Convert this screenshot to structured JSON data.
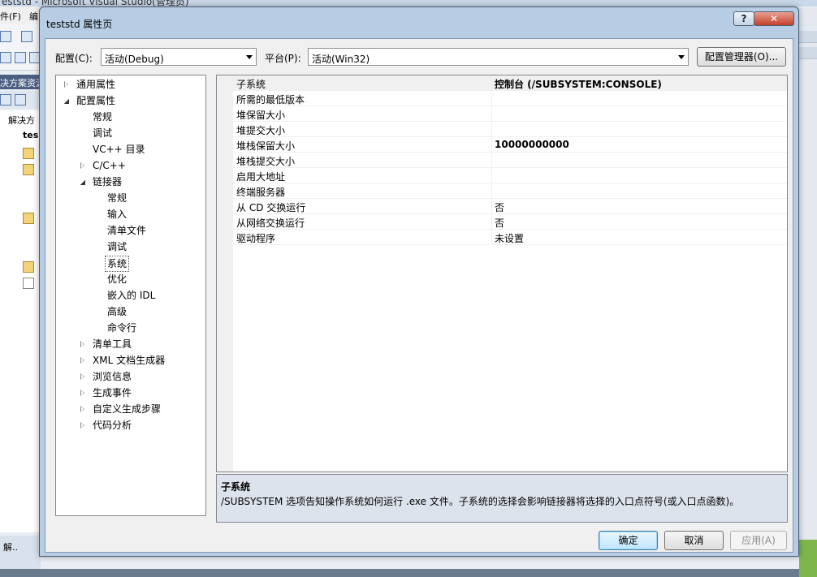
{
  "background": {
    "title_fragment": "eststd - Microsoft Visual Studio(管理员)",
    "menu": [
      "件(F)",
      "编"
    ],
    "solution_explorer_title": "决方案资源",
    "tree_items": [
      "解决方",
      "tes"
    ],
    "bottom_tab": "解.."
  },
  "dialog": {
    "title": "teststd 属性页",
    "help_label": "?",
    "close_label": "✕"
  },
  "config": {
    "label": "配置(C):",
    "value": "活动(Debug)"
  },
  "platform": {
    "label": "平台(P):",
    "value": "活动(Win32)"
  },
  "config_manager_label": "配置管理器(O)...",
  "tree": [
    {
      "label": "通用属性",
      "level": 0,
      "state": "closed"
    },
    {
      "label": "配置属性",
      "level": 0,
      "state": "open"
    },
    {
      "label": "常规",
      "level": 1,
      "state": "leaf"
    },
    {
      "label": "调试",
      "level": 1,
      "state": "leaf"
    },
    {
      "label": "VC++ 目录",
      "level": 1,
      "state": "leaf"
    },
    {
      "label": "C/C++",
      "level": 1,
      "state": "closed"
    },
    {
      "label": "链接器",
      "level": 1,
      "state": "open"
    },
    {
      "label": "常规",
      "level": 2,
      "state": "leaf"
    },
    {
      "label": "输入",
      "level": 2,
      "state": "leaf"
    },
    {
      "label": "清单文件",
      "level": 2,
      "state": "leaf"
    },
    {
      "label": "调试",
      "level": 2,
      "state": "leaf"
    },
    {
      "label": "系统",
      "level": 2,
      "state": "leaf",
      "selected": true
    },
    {
      "label": "优化",
      "level": 2,
      "state": "leaf"
    },
    {
      "label": "嵌入的 IDL",
      "level": 2,
      "state": "leaf"
    },
    {
      "label": "高级",
      "level": 2,
      "state": "leaf"
    },
    {
      "label": "命令行",
      "level": 2,
      "state": "leaf"
    },
    {
      "label": "清单工具",
      "level": 1,
      "state": "closed"
    },
    {
      "label": "XML 文档生成器",
      "level": 1,
      "state": "closed"
    },
    {
      "label": "浏览信息",
      "level": 1,
      "state": "closed"
    },
    {
      "label": "生成事件",
      "level": 1,
      "state": "closed"
    },
    {
      "label": "自定义生成步骤",
      "level": 1,
      "state": "closed"
    },
    {
      "label": "代码分析",
      "level": 1,
      "state": "closed"
    }
  ],
  "properties": [
    {
      "name": "子系统",
      "value": "控制台 (/SUBSYSTEM:CONSOLE)",
      "bold": true,
      "selected": true
    },
    {
      "name": "所需的最低版本",
      "value": ""
    },
    {
      "name": "堆保留大小",
      "value": ""
    },
    {
      "name": "堆提交大小",
      "value": ""
    },
    {
      "name": "堆栈保留大小",
      "value": "10000000000",
      "bold": true
    },
    {
      "name": "堆栈提交大小",
      "value": ""
    },
    {
      "name": "启用大地址",
      "value": ""
    },
    {
      "name": "终端服务器",
      "value": ""
    },
    {
      "name": "从 CD 交换运行",
      "value": "否"
    },
    {
      "name": "从网络交换运行",
      "value": "否"
    },
    {
      "name": "驱动程序",
      "value": "未设置"
    }
  ],
  "description": {
    "title": "子系统",
    "text": "/SUBSYSTEM 选项告知操作系统如何运行 .exe 文件。子系统的选择会影响链接器将选择的入口点符号(或入口点函数)。"
  },
  "buttons": {
    "ok": "确定",
    "cancel": "取消",
    "apply": "应用(A)"
  }
}
